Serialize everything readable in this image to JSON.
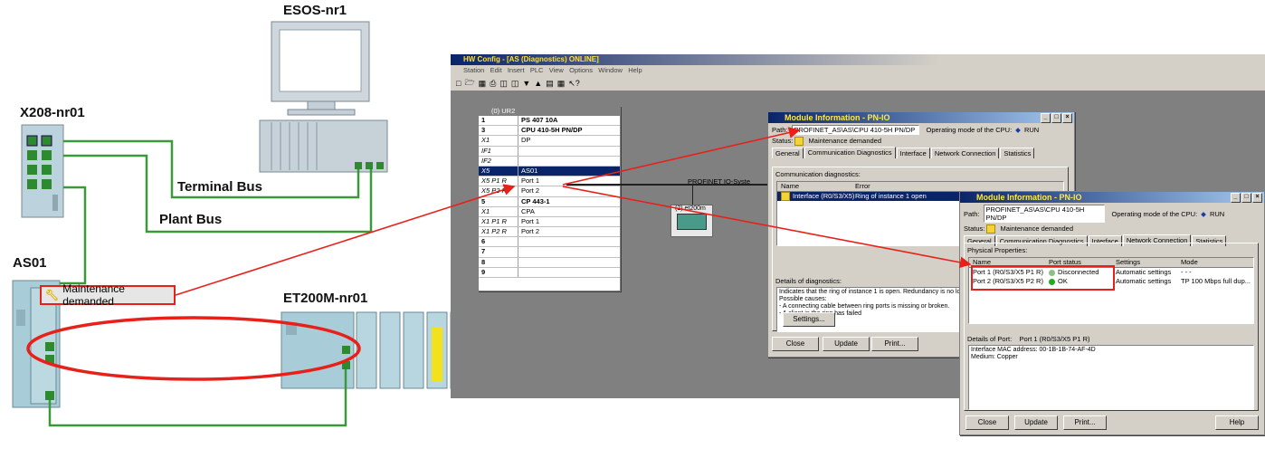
{
  "labels": {
    "esos": "ESOS-nr1",
    "x208": "X208-nr01",
    "as01": "AS01",
    "et200m": "ET200M-nr01",
    "terminal_bus": "Terminal Bus",
    "plant_bus": "Plant Bus",
    "maintenance": "Maintenance demanded"
  },
  "hwconfig": {
    "title": "HW Config - [AS (Diagnostics)  ONLINE]",
    "menu": [
      "Station",
      "Edit",
      "Insert",
      "PLC",
      "View",
      "Options",
      "Window",
      "Help"
    ],
    "rack_title": "(0) UR2",
    "rows": [
      {
        "slot": "1",
        "mod": "PS 407 10A"
      },
      {
        "slot": "3",
        "mod": "CPU 410-5H PN/DP"
      },
      {
        "slot": "X1",
        "mod": "DP"
      },
      {
        "slot": "IF1",
        "mod": ""
      },
      {
        "slot": "IF2",
        "mod": ""
      },
      {
        "slot": "X5",
        "mod": "AS01"
      },
      {
        "slot": "X5 P1 R",
        "mod": "Port 1"
      },
      {
        "slot": "X5 P2 R",
        "mod": "Port 2"
      },
      {
        "slot": "5",
        "mod": "CP 443-1"
      },
      {
        "slot": "X1",
        "mod": "CPA"
      },
      {
        "slot": "X1 P1 R",
        "mod": "Port 1"
      },
      {
        "slot": "X1 P2 R",
        "mod": "Port 2"
      },
      {
        "slot": "6",
        "mod": ""
      },
      {
        "slot": "7",
        "mod": ""
      },
      {
        "slot": "8",
        "mod": ""
      },
      {
        "slot": "9",
        "mod": ""
      }
    ],
    "profinet_label": "PROFINET IO-Syste",
    "et200_label": "(2) et200m"
  },
  "modinfo1": {
    "title": "Module Information - PN-IO",
    "path_label": "Path:",
    "path": "PROFINET_AS\\AS\\CPU 410-5H PN/DP",
    "opmode_label": "Operating mode of the CPU:",
    "opmode": "RUN",
    "status_label": "Status:",
    "status": "Maintenance demanded",
    "tabs": [
      "General",
      "Communication Diagnostics",
      "Interface",
      "Network Connection",
      "Statistics"
    ],
    "comm_diag_label": "Communication diagnostics:",
    "col_name": "Name",
    "col_error": "Error",
    "row_name": "Interface (R0/S3/X5)",
    "row_error": "Ring of instance 1 open",
    "details_label": "Details of diagnostics:",
    "details": [
      "Indicates that the ring of instance 1 is open. Redundancy is no long",
      "Possible causes:",
      " - A connecting cable between ring ports is missing or broken.",
      " - A client in the ring has failed"
    ],
    "settings_btn": "Settings...",
    "close_btn": "Close",
    "update_btn": "Update",
    "print_btn": "Print..."
  },
  "modinfo2": {
    "title": "Module Information - PN-IO",
    "path_label": "Path:",
    "path": "PROFINET_AS\\AS\\CPU 410-5H PN/DP",
    "opmode_label": "Operating mode of the CPU:",
    "opmode": "RUN",
    "status_label": "Status:",
    "status": "Maintenance demanded",
    "tabs": [
      "General",
      "Communication Diagnostics",
      "Interface",
      "Network Connection",
      "Statistics"
    ],
    "phys_label": "Physical Properties:",
    "cols": [
      "Name",
      "Port status",
      "Settings",
      "Mode"
    ],
    "ports": [
      {
        "name": "Port 1 (R0/S3/X5 P1 R)",
        "status": "Disconnected",
        "settings": "Automatic settings",
        "mode": "- - -"
      },
      {
        "name": "Port 2 (R0/S3/X5 P2 R)",
        "status": "OK",
        "settings": "Automatic settings",
        "mode": "TP 100 Mbps full dup..."
      }
    ],
    "details_port_label": "Details of Port:",
    "details_port": "Port 1 (R0/S3/X5 P1 R)",
    "mac": "Interface MAC address:  00-1B-1B-74-AF-4D",
    "medium": "Medium:  Copper",
    "close_btn": "Close",
    "update_btn": "Update",
    "print_btn": "Print...",
    "help_btn": "Help"
  },
  "colors": {
    "bus_green": "#3a9a3a",
    "alert_red": "#e8201a",
    "module_blue": "#a9cdd8"
  }
}
